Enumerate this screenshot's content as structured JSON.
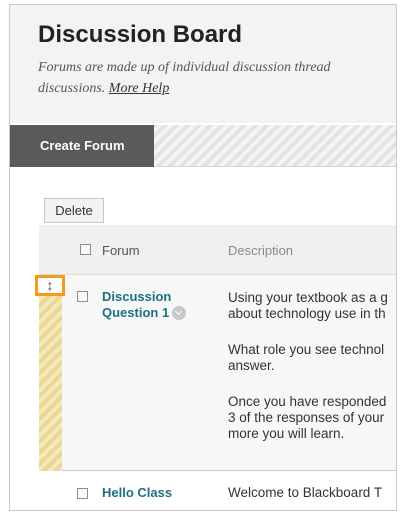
{
  "header": {
    "title": "Discussion Board",
    "description_line1": "Forums are made up of individual discussion thread",
    "description_line2": "discussions.",
    "more_help": "More Help"
  },
  "action_bar": {
    "create_forum_label": "Create Forum"
  },
  "list_actions": {
    "delete_label": "Delete"
  },
  "table": {
    "columns": [
      "Forum",
      "Description"
    ],
    "rows": [
      {
        "forum_line1": "Discussion",
        "forum_line2": "Question 1",
        "desc_p1_l1": "Using your textbook as a g",
        "desc_p1_l2": "about technology use in th",
        "desc_p2_l1": "What role you see technol",
        "desc_p2_l2": "answer.",
        "desc_p3_l1": "Once you have responded",
        "desc_p3_l2": "3 of the responses of your",
        "desc_p3_l3": "more you will learn."
      },
      {
        "forum": "Hello Class",
        "desc": "Welcome to Blackboard T"
      }
    ]
  },
  "drag_handle_glyph": "↕",
  "icons": {
    "drag_handle": "updown-arrow-icon",
    "row_menu": "chevron-down-icon"
  },
  "colors": {
    "link": "#1b7180",
    "drag_highlight": "#f39b1c",
    "create_button_bg": "#5a5a5a"
  }
}
